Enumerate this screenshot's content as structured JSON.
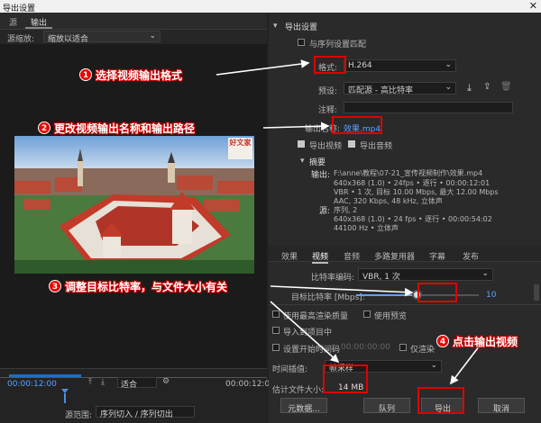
{
  "window": {
    "title": "导出设置",
    "close": "✕"
  },
  "left": {
    "tabs": [
      "源",
      "输出"
    ],
    "scaling_label": "源缩放:",
    "scaling_value": "缩放以适合",
    "timecode_start": "00:00:12:00",
    "timecode_end": "00:00:12:01",
    "fit_value": "适合",
    "range_label": "源范围:",
    "range_value": "序列切入 / 序列切出"
  },
  "export": {
    "section_title": "导出设置",
    "match_sequence": "与序列设置匹配",
    "format_label": "格式:",
    "format_value": "H.264",
    "preset_label": "预设:",
    "preset_value": "匹配源 - 高比特率",
    "comments_label": "注释:",
    "output_name_label": "输出名称:",
    "output_name_value": "效果.mp4",
    "export_video": "导出视频",
    "export_audio": "导出音频",
    "summary_title": "摘要",
    "output_label": "输出:",
    "output_lines": [
      "F:\\anne\\教程\\07-21_宣传视频制作\\效果.mp4",
      "640x368 (1.0) • 24fps • 逐行 • 00:00:12:01",
      "VBR • 1 次, 目标 10.00 Mbps, 最大 12.00 Mbps",
      "AAC, 320 Kbps, 48 kHz, 立体声"
    ],
    "source_label": "源:",
    "source_lines": [
      "序列, 2",
      "640x368 (1.0) • 24 fps • 逐行 • 00:00:54:02",
      "44100 Hz • 立体声"
    ]
  },
  "settings_tabs": [
    "效果",
    "视频",
    "音频",
    "多路复用器",
    "字幕",
    "发布"
  ],
  "bitrate": {
    "encoding_label": "比特率编码:",
    "encoding_value": "VBR, 1 次",
    "target_label": "目标比特率 [Mbps]:",
    "target_value": "10",
    "slider_level": 0.5
  },
  "options": {
    "max_render": "使用最高渲染质量",
    "use_preview": "使用预览",
    "import_project": "导入到项目中",
    "set_start_tc": "设置开始时间码",
    "timecode_value": "00:00:00:00",
    "render_alpha": "仅渲染",
    "interp_label": "时间插值:",
    "interp_value": "帧采样",
    "filesize_label": "估计文件大小:",
    "filesize_value": "14 MB"
  },
  "buttons": {
    "metadata": "元数据...",
    "queue": "队列",
    "export": "导出",
    "cancel": "取消"
  },
  "annotations": [
    {
      "num": "1",
      "text": "选择视频输出格式"
    },
    {
      "num": "2",
      "text": "更改视频输出名称和输出路径"
    },
    {
      "num": "3",
      "text": "调整目标比特率，与文件大小有关"
    },
    {
      "num": "4",
      "text": "点击输出视频"
    }
  ],
  "logo_text": "好文家",
  "colors": {
    "accent": "#5aa3ff",
    "annotation": "#e00000"
  }
}
